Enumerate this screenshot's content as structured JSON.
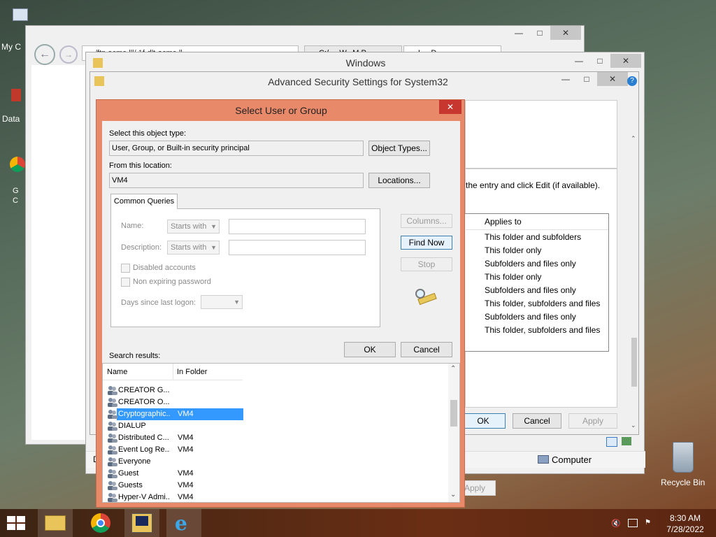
{
  "desktop": {
    "icons": [
      {
        "label": "My C",
        "name": "my-computer"
      },
      {
        "label": "Data",
        "name": "data"
      },
      {
        "label": "G\nC",
        "name": "google-chrome"
      }
    ],
    "recycle_bin": "Recycle Bin"
  },
  "explorer_window": {
    "address_text": "/ftp.acme.lll/ 1f-dlt-acme.ll",
    "tab1": "C:/..., W...M P...",
    "tab2": "L... D..."
  },
  "windows_window": {
    "title": "Windows"
  },
  "adv_security": {
    "title": "Advanced Security Settings for System32",
    "instruction": "the entry and click Edit (if available).",
    "applies_header": "Applies to",
    "applies_rows": [
      "This folder and subfolders",
      "This folder only",
      "Subfolders and files only",
      "This folder only",
      "Subfolders and files only",
      "This folder, subfolders and files",
      "Subfolders and files only",
      "This folder, subfolders and files"
    ],
    "ok": "OK",
    "cancel": "Cancel",
    "apply": "Apply"
  },
  "behind_window": {
    "apply": "Apply",
    "status_computer": "Computer",
    "status_d": "D"
  },
  "dialog": {
    "title": "Select User or Group",
    "object_type_label": "Select this object type:",
    "object_type_value": "User, Group, or Built-in security principal",
    "object_types_button": "Object Types...",
    "location_label": "From this location:",
    "location_value": "VM4",
    "locations_button": "Locations...",
    "tab_common": "Common Queries",
    "name_label": "Name:",
    "name_combo": "Starts with",
    "desc_label": "Description:",
    "desc_combo": "Starts with",
    "disabled_accounts": "Disabled accounts",
    "non_expiring": "Non expiring password",
    "days_label": "Days since last logon:",
    "columns_button": "Columns...",
    "find_now_button": "Find Now",
    "stop_button": "Stop",
    "ok_button": "OK",
    "cancel_button": "Cancel",
    "search_results_label": "Search results:",
    "col_name": "Name",
    "col_folder": "In Folder",
    "results": [
      {
        "name": "CREATOR G...",
        "folder": ""
      },
      {
        "name": "CREATOR O...",
        "folder": ""
      },
      {
        "name": "Cryptographic...",
        "folder": "VM4"
      },
      {
        "name": "DIALUP",
        "folder": ""
      },
      {
        "name": "Distributed C...",
        "folder": "VM4"
      },
      {
        "name": "Event Log Re...",
        "folder": "VM4"
      },
      {
        "name": "Everyone",
        "folder": ""
      },
      {
        "name": "Guest",
        "folder": "VM4"
      },
      {
        "name": "Guests",
        "folder": "VM4"
      },
      {
        "name": "Hyper-V Admi...",
        "folder": "VM4"
      }
    ],
    "selected_index": 2
  },
  "taskbar": {
    "time": "8:30 AM",
    "date": "7/28/2022",
    "apps": [
      "file-explorer",
      "chrome",
      "powershell",
      "internet-explorer"
    ]
  },
  "colors": {
    "dialog_frame": "#e8896a",
    "selection": "#3399ff",
    "taskbar": "#5a2a14"
  }
}
